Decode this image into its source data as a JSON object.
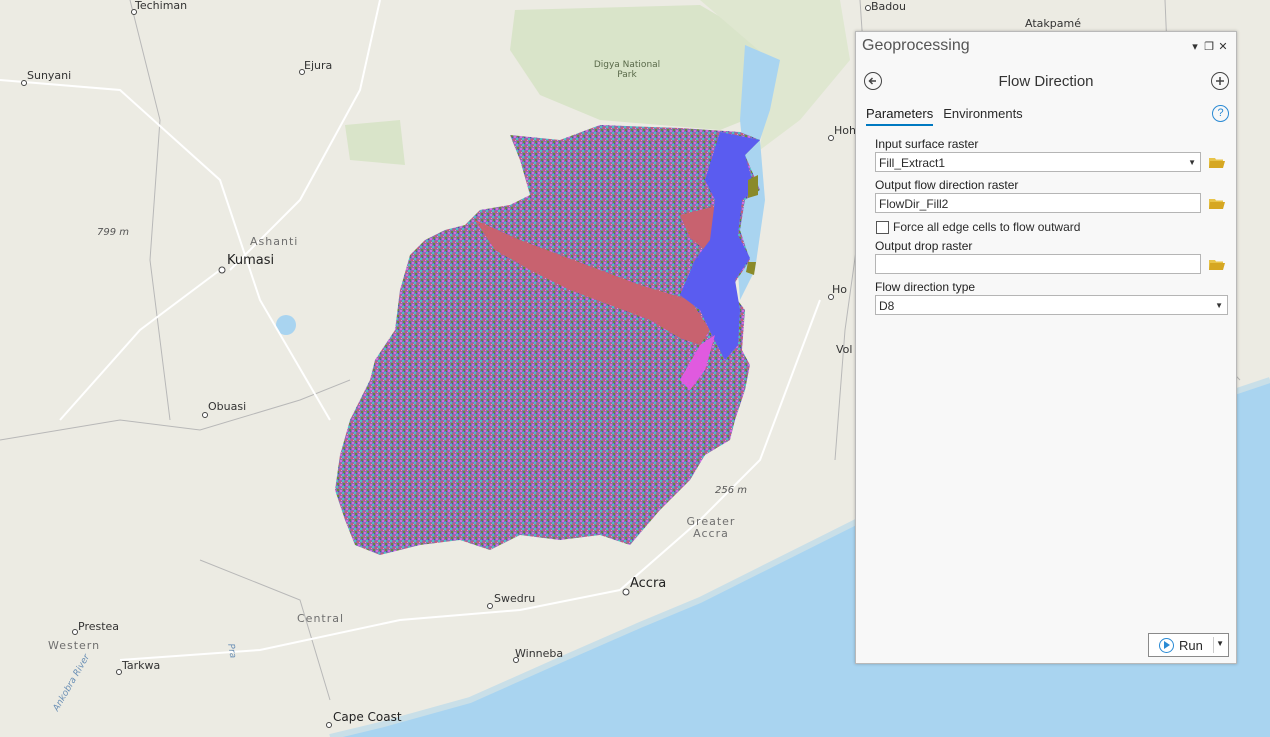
{
  "map": {
    "places": [
      {
        "name": "Techiman"
      },
      {
        "name": "Sunyani"
      },
      {
        "name": "Ejura"
      },
      {
        "name": "Ashanti"
      },
      {
        "name": "Kumasi"
      },
      {
        "name": "Obuasi"
      },
      {
        "name": "799 m"
      },
      {
        "name": "Digya National Park"
      },
      {
        "name": "Badou"
      },
      {
        "name": "Atakpamé"
      },
      {
        "name": "Hoh"
      },
      {
        "name": "Ho"
      },
      {
        "name": "Vol"
      },
      {
        "name": "256 m"
      },
      {
        "name": "Greater Accra"
      },
      {
        "name": "Accra"
      },
      {
        "name": "Swedru"
      },
      {
        "name": "Central"
      },
      {
        "name": "Winneba"
      },
      {
        "name": "Prestea"
      },
      {
        "name": "Western"
      },
      {
        "name": "Tarkwa"
      },
      {
        "name": "Ankobra River"
      },
      {
        "name": "Pra"
      },
      {
        "name": "Cape Coast"
      }
    ],
    "colors": {
      "land": "#ecebe3",
      "sea": "#a9d4f0",
      "raster_flat_red": "#c8626f",
      "raster_flat_blue": "#5a5cf0"
    }
  },
  "geoprocessing": {
    "pane_title": "Geoprocessing",
    "window_buttons": [
      "▾",
      "❐",
      "✕"
    ],
    "tool_name": "Flow Direction",
    "tabs": [
      {
        "label": "Parameters",
        "active": true
      },
      {
        "label": "Environments",
        "active": false
      }
    ],
    "help": "?",
    "params": {
      "input_surface_label": "Input surface raster",
      "input_surface_value": "Fill_Extract1",
      "output_flow_label": "Output flow direction raster",
      "output_flow_value": "FlowDir_Fill2",
      "force_edge_label": "Force all edge cells to flow outward",
      "force_edge_checked": false,
      "output_drop_label": "Output drop raster",
      "output_drop_value": "",
      "flow_type_label": "Flow direction type",
      "flow_type_value": "D8"
    },
    "run_label": "Run",
    "accent": "#0079c1"
  }
}
